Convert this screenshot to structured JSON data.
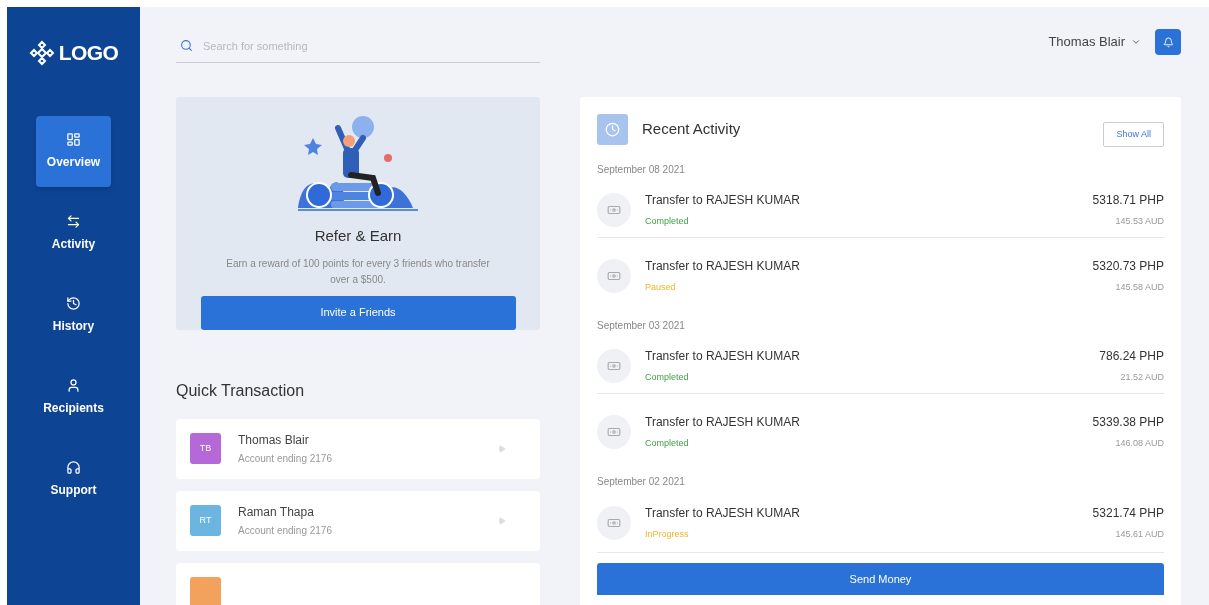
{
  "sidebar": {
    "logo": "LOGO",
    "items": [
      {
        "label": "Overview",
        "selected": true
      },
      {
        "label": "Activity",
        "selected": false
      },
      {
        "label": "History",
        "selected": false
      },
      {
        "label": "Recipients",
        "selected": false
      },
      {
        "label": "Support",
        "selected": false
      }
    ]
  },
  "search": {
    "placeholder": "Search for something"
  },
  "user": {
    "name": "Thomas Blair"
  },
  "refer": {
    "title": "Refer & Earn",
    "text": "Earn a reward of 100 points for every 3 friends who transfer over a $500.",
    "button": "Invite a Friends"
  },
  "quick_transaction": {
    "title": "Quick Transaction",
    "contacts": [
      {
        "initials": "TB",
        "name": "Thomas Blair",
        "account": "Account ending 2176",
        "color": "#b569d8"
      },
      {
        "initials": "RT",
        "name": "Raman Thapa",
        "account": "Account ending 2176",
        "color": "#6bb5e0"
      },
      {
        "color": "#f2a25c"
      }
    ]
  },
  "recent_activity": {
    "title": "Recent Activity",
    "show_all": "Show All",
    "groups": [
      {
        "date": "September 08 2021",
        "items": [
          {
            "title": "Transfer to RAJESH KUMAR",
            "status": "Completed",
            "kind": "done",
            "amount": "5318.71 PHP",
            "converted": "145.53 AUD"
          },
          {
            "title": "Transfer to RAJESH KUMAR",
            "status": "Paused",
            "kind": "pending",
            "amount": "5320.73 PHP",
            "converted": "145.58 AUD"
          }
        ]
      },
      {
        "date": "September 03 2021",
        "items": [
          {
            "title": "Transfer to RAJESH KUMAR",
            "status": "Completed",
            "kind": "done",
            "amount": "786.24 PHP",
            "converted": "21.52 AUD"
          },
          {
            "title": "Transfer to RAJESH KUMAR",
            "status": "Completed",
            "kind": "done",
            "amount": "5339.38 PHP",
            "converted": "146.08 AUD"
          }
        ]
      },
      {
        "date": "September 02 2021",
        "items": [
          {
            "title": "Transfer to RAJESH KUMAR",
            "status": "InProgress",
            "kind": "pending",
            "amount": "5321.74 PHP",
            "converted": "145.61 AUD"
          }
        ]
      }
    ],
    "button": "Send Money"
  }
}
